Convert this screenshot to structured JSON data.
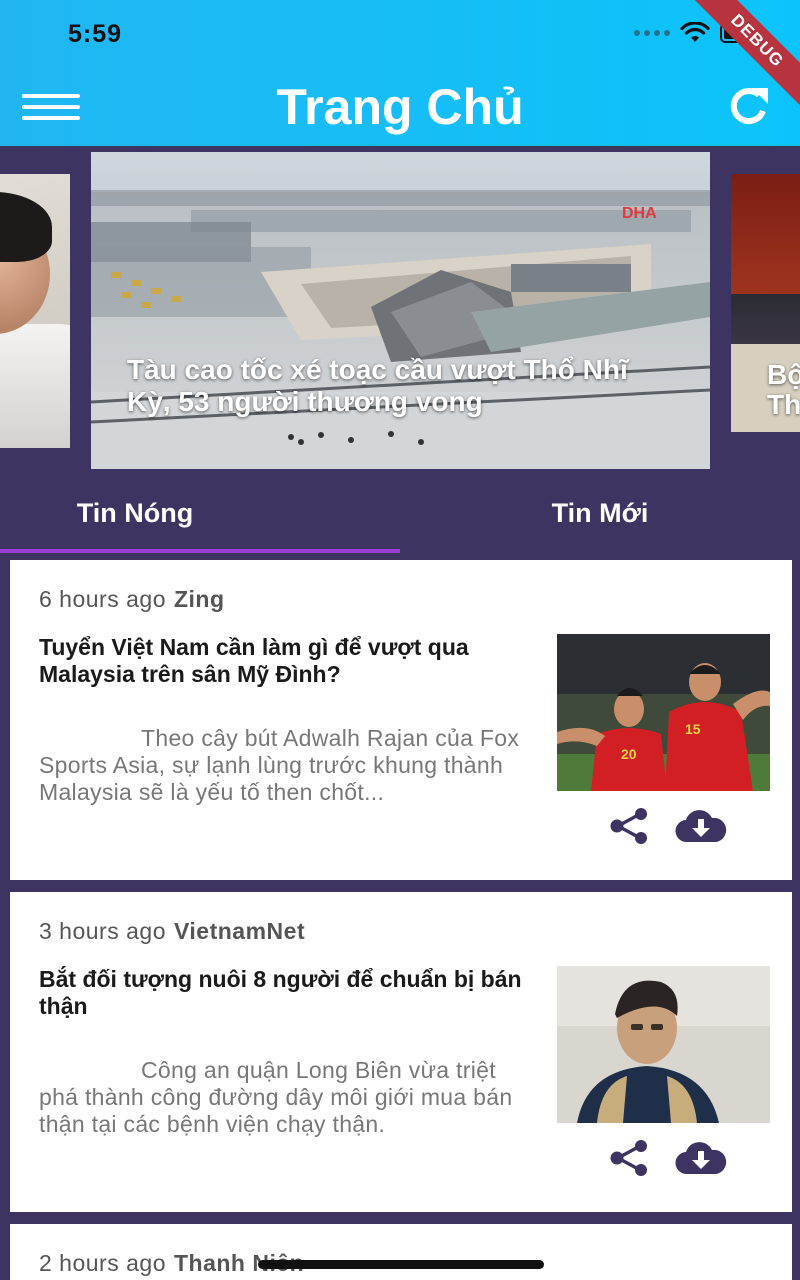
{
  "status_bar": {
    "time": "5:59",
    "debug_label": "DEBUG"
  },
  "header": {
    "title": "Trang Chủ",
    "menu_icon": "hamburger-menu-icon",
    "refresh_icon": "refresh-icon"
  },
  "carousel": {
    "main_caption": "Tàu cao tốc xé toạc cầu vượt Thổ Nhĩ Kỳ, 53 người thương vong",
    "main_watermark": "DHA",
    "right_caption": "Bộ\nTh"
  },
  "tabs": [
    {
      "label": "Tin Nóng",
      "active": true
    },
    {
      "label": "Tin Mới",
      "active": false
    }
  ],
  "colors": {
    "header": "#21b6f2",
    "background": "#3d3462",
    "tab_indicator": "#9b3fd2",
    "icon": "#3d3462"
  },
  "articles": [
    {
      "time": "6 hours ago",
      "source": "Zing",
      "title": "Tuyển Việt Nam cần làm gì để vượt qua Malaysia trên sân Mỹ Đình?",
      "excerpt": "Theo cây bút Adwalh Rajan của Fox Sports Asia, sự lạnh lùng trước khung thành Malaysia sẽ là yếu tố then chốt...",
      "jersey_numbers": [
        "20",
        "15"
      ]
    },
    {
      "time": "3 hours ago",
      "source": "VietnamNet",
      "title": "Bắt đối tượng nuôi 8 người để chuẩn bị bán thận",
      "excerpt": "Công an quận Long Biên vừa triệt phá thành công đường dây môi giới mua bán thận tại các bệnh viện chạy thận."
    },
    {
      "time": "2 hours ago",
      "source": "Thanh Niên"
    }
  ]
}
